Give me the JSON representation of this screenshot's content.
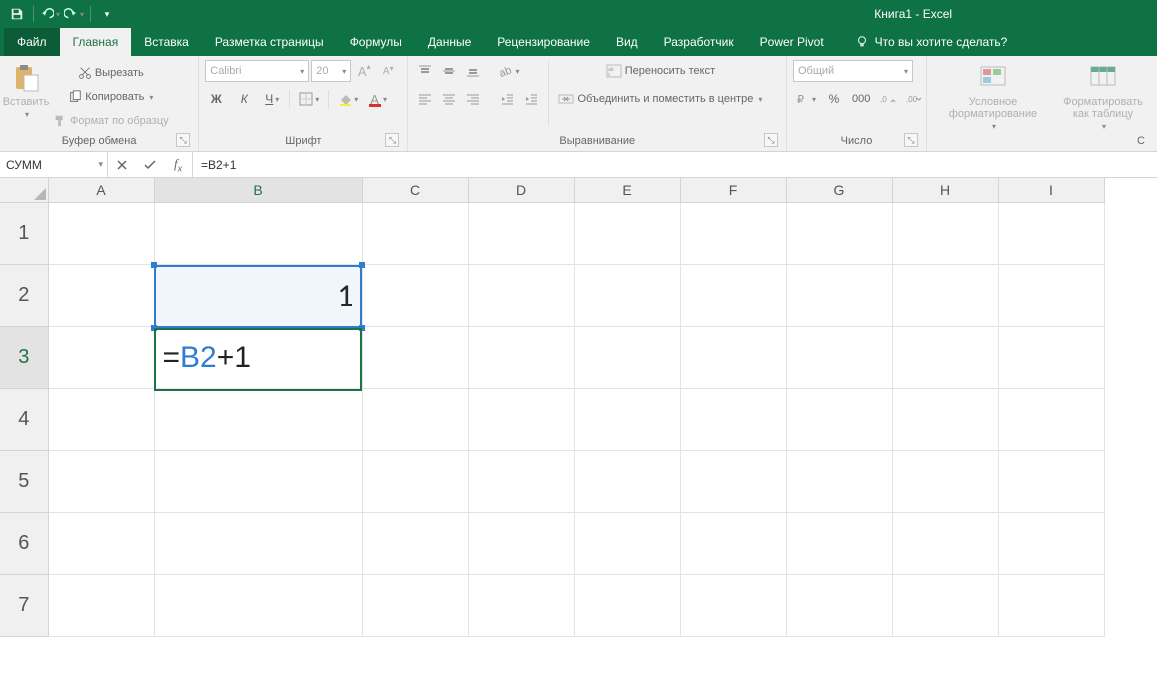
{
  "title": "Книга1  -  Excel",
  "tabs": {
    "file": "Файл",
    "home": "Главная",
    "insert": "Вставка",
    "page_layout": "Разметка страницы",
    "formulas": "Формулы",
    "data": "Данные",
    "review": "Рецензирование",
    "view": "Вид",
    "developer": "Разработчик",
    "powerpivot": "Power Pivot",
    "tell_me": "Что вы хотите сделать?"
  },
  "ribbon": {
    "clipboard": {
      "paste": "Вставить",
      "cut": "Вырезать",
      "copy": "Копировать",
      "format_painter": "Формат по образцу",
      "label": "Буфер обмена"
    },
    "font": {
      "name": "Calibri",
      "size": "20",
      "label": "Шрифт"
    },
    "alignment": {
      "wrap": "Переносить текст",
      "merge": "Объединить и поместить в центре",
      "label": "Выравнивание"
    },
    "number": {
      "format": "Общий",
      "label": "Число"
    },
    "styles": {
      "conditional": "Условное форматирование",
      "as_table": "Форматировать как таблицу"
    }
  },
  "formula_bar": {
    "name_box": "СУММ",
    "formula": "=B2+1"
  },
  "grid": {
    "columns": [
      "A",
      "B",
      "C",
      "D",
      "E",
      "F",
      "G",
      "H",
      "I"
    ],
    "rows": [
      "1",
      "2",
      "3",
      "4",
      "5",
      "6",
      "7"
    ],
    "b2_value": "1",
    "b3_edit_prefix": "=",
    "b3_edit_ref": "B2",
    "b3_edit_suffix": "+1"
  }
}
